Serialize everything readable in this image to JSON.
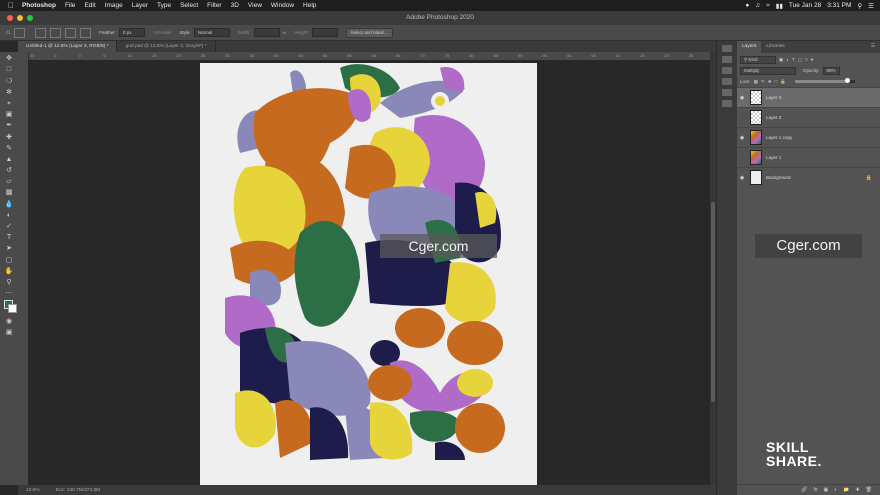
{
  "menubar": {
    "app": "Photoshop",
    "items": [
      "File",
      "Edit",
      "Image",
      "Layer",
      "Type",
      "Select",
      "Filter",
      "3D",
      "View",
      "Window",
      "Help"
    ],
    "status": {
      "date": "Tue Jan 28",
      "time": "3:31 PM"
    }
  },
  "window": {
    "title": "Adobe Photoshop 2020"
  },
  "options": {
    "feather_label": "Feather:",
    "feather_value": "0 px",
    "antialias_label": "Anti-alias",
    "style_label": "Style:",
    "style_value": "Normal",
    "width_label": "Width:",
    "height_label": "Height:",
    "select_mask": "Select and Mask..."
  },
  "tabs": [
    {
      "label": "Untitled-1 @ 12.5% (Layer 3, RGB/8) *"
    },
    {
      "label": "graf.psd @ 12.5% (Layer 2, Gray/8*) *"
    }
  ],
  "ruler": [
    "10",
    "5",
    "0",
    "5",
    "10",
    "15",
    "20",
    "25",
    "30",
    "35",
    "40",
    "45",
    "50",
    "55",
    "60",
    "65",
    "70",
    "75",
    "80",
    "85",
    "90",
    "95",
    "00",
    "05",
    "10",
    "15",
    "20",
    "25"
  ],
  "status": {
    "zoom": "12.5%",
    "doc": "Doc: 135.7M/374.3M"
  },
  "panel": {
    "tabs": [
      "Layers",
      "Libraries"
    ],
    "kind": "Kind",
    "blend": "Multiply",
    "opacity_label": "Opacity:",
    "opacity": "89%",
    "lock_label": "Lock:",
    "fill_level": 0.86,
    "layers": [
      {
        "name": "Layer 3",
        "selected": true,
        "visible": true
      },
      {
        "name": "Layer 2",
        "selected": false,
        "visible": false
      },
      {
        "name": "Layer 1 copy",
        "selected": false,
        "visible": true
      },
      {
        "name": "Layer 1",
        "selected": false,
        "visible": false
      },
      {
        "name": "Background",
        "selected": false,
        "visible": true,
        "locked": true
      }
    ]
  },
  "watermark": {
    "text": "Cger.com"
  },
  "logo": {
    "line1": "SKILL",
    "line2": "SHARE."
  },
  "colors": {
    "yellow": "#e6d43a",
    "orange": "#c56a1e",
    "purple": "#b06ac8",
    "navy": "#1e1c4a",
    "lavender": "#8a88b8",
    "green": "#2c6e45",
    "white": "#efefef"
  }
}
